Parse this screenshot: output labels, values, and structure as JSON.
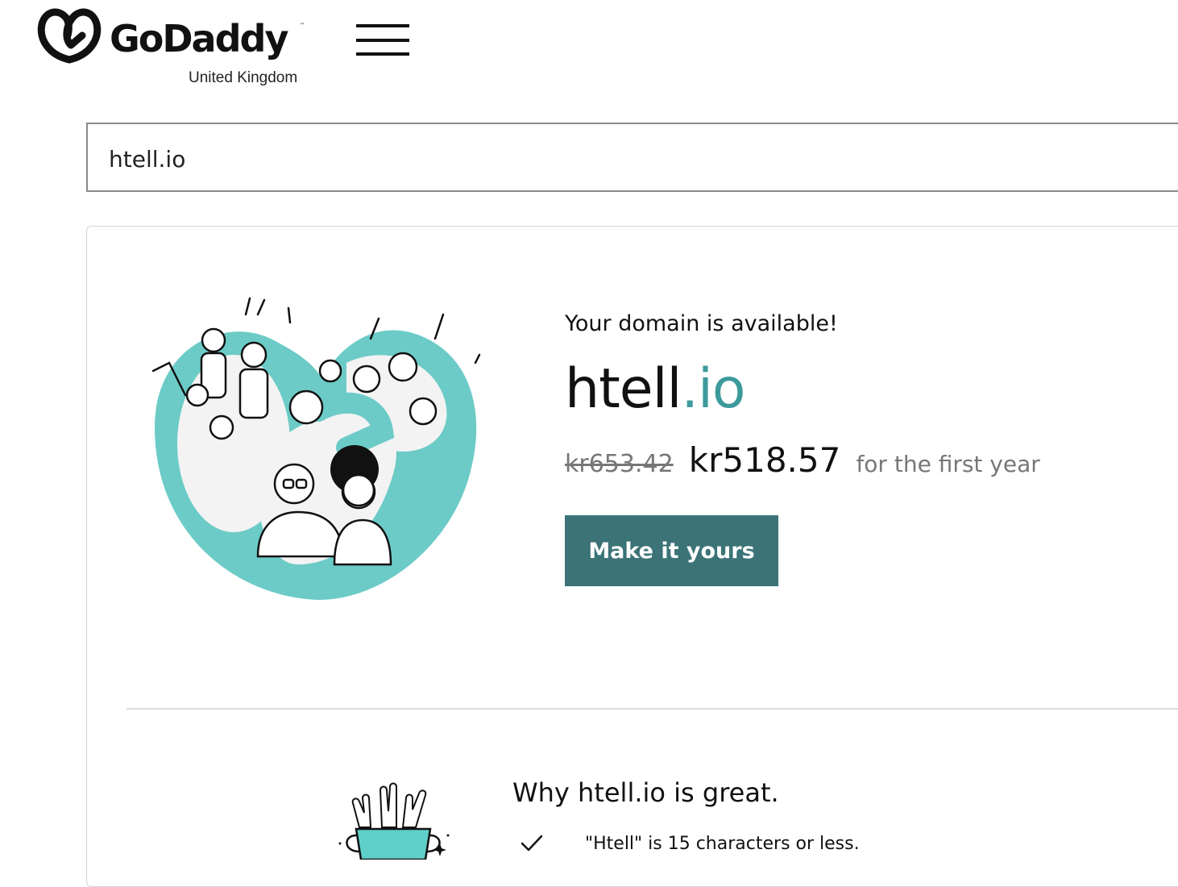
{
  "header": {
    "brand": "GoDaddy",
    "trademark": "™",
    "region": "United Kingdom",
    "menu_icon": "hamburger-menu-icon"
  },
  "search": {
    "value": "htell.io"
  },
  "result": {
    "availability_text": "Your domain is available!",
    "domain_name": "htell",
    "domain_tld": ".io",
    "old_price": "kr653.42",
    "new_price": "kr518.57",
    "price_term": "for the first year",
    "cta_label": "Make it yours",
    "illustration": "celebrating-people-illustration"
  },
  "why": {
    "title": "Why htell.io is great.",
    "illustration": "trophy-hands-illustration",
    "reasons": [
      {
        "icon": "check-icon",
        "text": "\"Htell\" is 15 characters or less."
      }
    ]
  },
  "colors": {
    "accent_teal": "#3d9a9c",
    "art_teal": "#6ccbc7",
    "button_bg": "#3b7377",
    "button_text": "#ffffff",
    "muted_text": "#777777"
  }
}
